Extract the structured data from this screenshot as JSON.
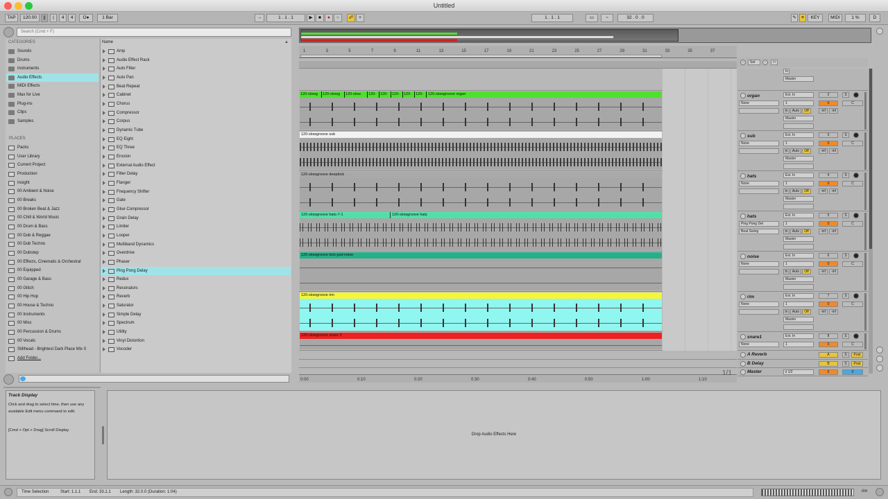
{
  "window": {
    "title": "Untitled"
  },
  "control_bar": {
    "tap": "TAP",
    "tempo": "120.00",
    "sig_num": "4",
    "sig_den": "4",
    "metro": "O●",
    "quant": "1 Bar",
    "pos_a": "1",
    "pos_b": "1",
    "pos_c": "1",
    "arr_a": "1",
    "arr_b": "1",
    "arr_c": "1",
    "len_a": "32",
    "len_b": "0",
    "len_c": "0",
    "key": "KEY",
    "midi": "MIDI",
    "cpu": "1 %",
    "d": "D"
  },
  "browser": {
    "search_placeholder": "Search (Cmd + F)",
    "categories_title": "CATEGORIES",
    "categories": [
      "Sounds",
      "Drums",
      "Instruments",
      "Audio Effects",
      "MIDI Effects",
      "Max for Live",
      "Plug-ins",
      "Clips",
      "Samples"
    ],
    "places_title": "PLACES",
    "places": [
      "Packs",
      "User Library",
      "Current Project",
      "Production",
      "Insight",
      "00 Ambient & Noise",
      "00 Breaks",
      "00 Broken Beat & Jazz",
      "00 Chill & World Music",
      "00 Drum & Bass",
      "00 Dub & Reggae",
      "00 Dub Techno",
      "00 Dubstep",
      "00 Effects, Cinematic & Orchestral",
      "00 Equipped",
      "00 Garage & Bass",
      "00 Glitch",
      "00 Hip Hop",
      "00 House & Techno",
      "00 Instruments",
      "00 Misc",
      "00 Percussion & Drums",
      "00 Vocals",
      "Stillhead - Brightest Dark Place Mix 0",
      "Add Folder..."
    ],
    "name_header": "Name",
    "effects": [
      "Amp",
      "Audio Effect Rack",
      "Auto Filter",
      "Auto Pan",
      "Beat Repeat",
      "Cabinet",
      "Chorus",
      "Compressor",
      "Corpus",
      "Dynamic Tube",
      "EQ Eight",
      "EQ Three",
      "Erosion",
      "External Audio Effect",
      "Filter Delay",
      "Flanger",
      "Frequency Shifter",
      "Gate",
      "Glue Compressor",
      "Grain Delay",
      "Limiter",
      "Looper",
      "Multiband Dynamics",
      "Overdrive",
      "Phaser",
      "Ping Pong Delay",
      "Redux",
      "Resonators",
      "Reverb",
      "Saturator",
      "Simple Delay",
      "Spectrum",
      "Utility",
      "Vinyl Distortion",
      "Vocoder"
    ]
  },
  "arrangement": {
    "bars": [
      "1",
      "3",
      "5",
      "7",
      "9",
      "11",
      "13",
      "15",
      "17",
      "19",
      "21",
      "23",
      "25",
      "27",
      "29",
      "31",
      "33",
      "35",
      "37"
    ],
    "times": [
      "0:00",
      "0:10",
      "0:20",
      "0:30",
      "0:40",
      "0:50",
      "1:00",
      "1:10"
    ],
    "page": "1/1",
    "set_label": "Set",
    "tracks": [
      {
        "clip": "120-slowgroove organ",
        "sub": [
          "120-slowg",
          "120-slowg",
          "120-slow",
          "120-",
          "120-",
          "120-",
          "120-",
          "120-"
        ],
        "color": "#4fe02f"
      },
      {
        "clip": "120-slowgroove sub",
        "color": "#f2f2f2"
      },
      {
        "clip": "120-slowgroove deepkick",
        "color": "#a9a9a9"
      },
      {
        "clip": "120-slowgroove hats-7-1",
        "clip2": "120-slowgroove hats",
        "color": "#4fe0a8"
      },
      {
        "clip": "120-slowgroove kick-just-noise",
        "color": "#23b08a"
      },
      {
        "clip": "120-slowgroove rim",
        "color": "#f5f53a"
      },
      {
        "clip": "120-slowgroove snare 2",
        "color": "#f02020"
      }
    ]
  },
  "mixer": {
    "tracks": [
      {
        "name": "organ",
        "input": "Ext. In",
        "chan": "1",
        "fx": "None",
        "num": "2",
        "out": "Master"
      },
      {
        "name": "sub",
        "input": "Ext. In",
        "chan": "1",
        "fx": "None",
        "num": "3",
        "out": "Master"
      },
      {
        "name": "hats",
        "input": "Ext. In",
        "chan": "1",
        "fx": "None",
        "num": "4",
        "out": "Master"
      },
      {
        "name": "hats",
        "input": "Ext. In",
        "chan": "1",
        "fx": "Ping Pong Del",
        "fx2": "Beat Swing",
        "num": "5",
        "out": "Master"
      },
      {
        "name": "noise",
        "input": "Ext. In",
        "chan": "1",
        "fx": "None",
        "num": "6",
        "out": "Master"
      },
      {
        "name": "rim",
        "input": "Ext. In",
        "chan": "1",
        "fx": "None",
        "num": "7",
        "out": "Master"
      },
      {
        "name": "snare1",
        "input": "Ext. In",
        "chan": "1",
        "fx": "None",
        "num": "8",
        "out": "Master"
      }
    ],
    "returns": [
      {
        "name": "A Reverb",
        "letter": "A",
        "post": "Post"
      },
      {
        "name": "B Delay",
        "letter": "B",
        "post": "Post"
      }
    ],
    "master": {
      "name": "Master",
      "out": "ii 1/2",
      "val": "0"
    },
    "labels": {
      "in": "In",
      "auto": "Auto",
      "off": "Off",
      "inf": "-inf",
      "s": "S",
      "c": "C",
      "zero": "0"
    }
  },
  "info": {
    "title": "Track Display",
    "body": "Click and drag to select time, then use any available Edit menu command to edit.",
    "hint": "[Cmd + Opt + Drag] Scroll Display"
  },
  "device": {
    "drop": "Drop Audio Effects Here"
  },
  "status": {
    "selection": "Time Selection",
    "start": "Start: 1.1.1",
    "end": "End: 33.1.1",
    "length": "Length: 32.0.0  (Duration: 1:04)",
    "track": "rim"
  }
}
